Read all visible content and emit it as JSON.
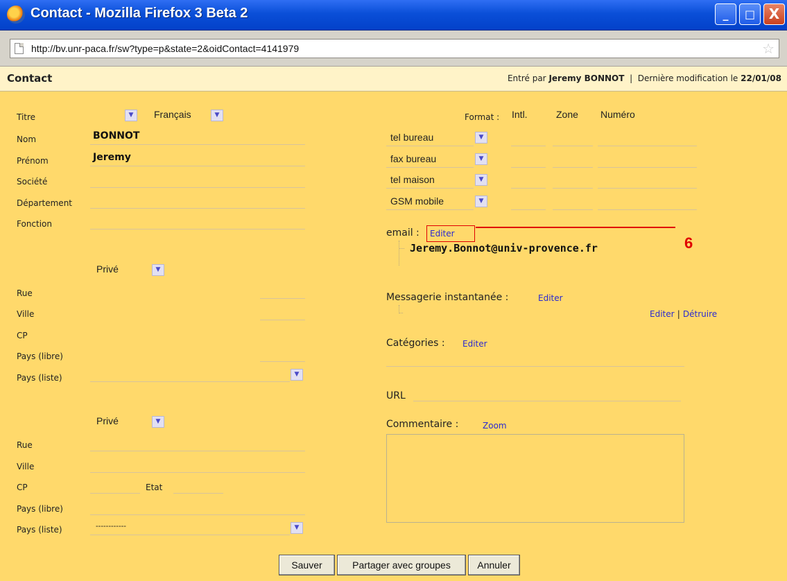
{
  "window": {
    "title": "Contact - Mozilla Firefox 3 Beta 2",
    "minimize": "_",
    "maximize": "□",
    "close": "X"
  },
  "address": {
    "url": "http://bv.unr-paca.fr/sw?type=p&state=2&oidContact=4141979"
  },
  "header": {
    "title": "Contact",
    "entered_by_label": "Entré par",
    "entered_by": "Jeremy BONNOT",
    "separator": "|",
    "modified_label": "Dernière modification le",
    "modified_date": "22/01/08"
  },
  "identity": {
    "titre_label": "Titre",
    "language": "Français",
    "nom_label": "Nom",
    "nom": "BONNOT",
    "prenom_label": "Prénom",
    "prenom": "Jeremy",
    "societe_label": "Société",
    "departement_label": "Département",
    "fonction_label": "Fonction"
  },
  "address1": {
    "type": "Privé",
    "rue_label": "Rue",
    "ville_label": "Ville",
    "cp_label": "CP",
    "pays_libre_label": "Pays (libre)",
    "pays_liste_label": "Pays (liste)",
    "pays_liste_value": ""
  },
  "address2": {
    "type": "Privé",
    "rue_label": "Rue",
    "ville_label": "Ville",
    "cp_label": "CP",
    "etat_label": "Etat",
    "pays_libre_label": "Pays (libre)",
    "pays_liste_label": "Pays (liste)",
    "pays_liste_value": "------------"
  },
  "phones": {
    "format_label": "Format :",
    "col_intl": "Intl.",
    "col_zone": "Zone",
    "col_numero": "Numéro",
    "rows": [
      "tel bureau",
      "fax bureau",
      "tel maison",
      "GSM mobile"
    ]
  },
  "email": {
    "label": "email :",
    "edit": "Editer",
    "value": "Jeremy.Bonnot@univ-provence.fr",
    "annotation": "6"
  },
  "im": {
    "label": "Messagerie instantanée :",
    "edit": "Editer",
    "edit2": "Editer",
    "sep": "|",
    "delete": "Détruire"
  },
  "categories": {
    "label": "Catégories :",
    "edit": "Editer"
  },
  "url_field": {
    "label": "URL"
  },
  "comment": {
    "label": "Commentaire :",
    "zoom": "Zoom",
    "value": ""
  },
  "buttons": {
    "save": "Sauver",
    "share": "Partager avec groupes",
    "cancel": "Annuler"
  },
  "colors": {
    "page_bg": "#ffd96b",
    "header_bg": "#fff3c8",
    "link": "#2a2ad0",
    "annotation": "#e00000",
    "titlebar": "#0a4fd8"
  }
}
